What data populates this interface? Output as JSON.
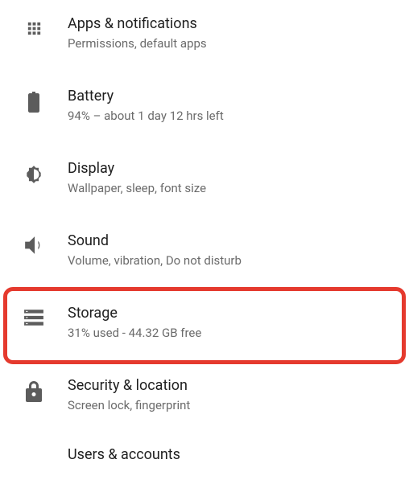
{
  "settings": {
    "items": [
      {
        "title": "Apps & notifications",
        "subtitle": "Permissions, default apps"
      },
      {
        "title": "Battery",
        "subtitle": "94% – about 1 day 12 hrs left"
      },
      {
        "title": "Display",
        "subtitle": "Wallpaper, sleep, font size"
      },
      {
        "title": "Sound",
        "subtitle": "Volume, vibration, Do not disturb"
      },
      {
        "title": "Storage",
        "subtitle": "31% used - 44.32 GB free"
      },
      {
        "title": "Security & location",
        "subtitle": "Screen lock, fingerprint"
      },
      {
        "title": "Users & accounts",
        "subtitle": ""
      }
    ]
  },
  "highlight_index": 4,
  "colors": {
    "highlight": "#e53a2e"
  }
}
